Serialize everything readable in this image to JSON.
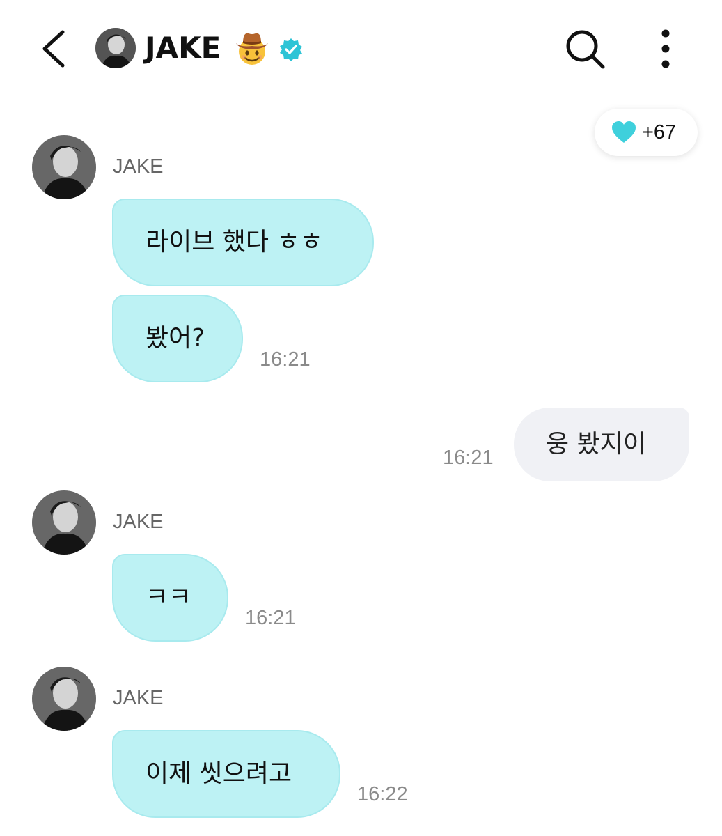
{
  "header": {
    "title": "JAKE",
    "title_emoji": "cowboy-hat-face",
    "verified_badge": "verified-check-icon",
    "back_icon": "chevron-left-icon",
    "search_icon": "search-icon",
    "more_icon": "more-vertical-icon"
  },
  "reaction": {
    "icon": "heart-icon",
    "count": "+67",
    "color": "#3fd0dc"
  },
  "colors": {
    "incoming_bubble": "#bdf2f4",
    "outgoing_bubble": "#f0f1f5",
    "verified": "#2ec4d6"
  },
  "messages": [
    {
      "sender": "JAKE"
    },
    {
      "text": "라이브 했다 ㅎㅎ"
    },
    {
      "text": "봤어?",
      "time": "16:21"
    },
    {
      "text": "웅 봤지이",
      "time": "16:21"
    },
    {
      "sender": "JAKE"
    },
    {
      "text": "ㅋㅋ",
      "time": "16:21"
    },
    {
      "sender": "JAKE"
    },
    {
      "text": "이제 씻으려고",
      "time": "16:22"
    }
  ]
}
